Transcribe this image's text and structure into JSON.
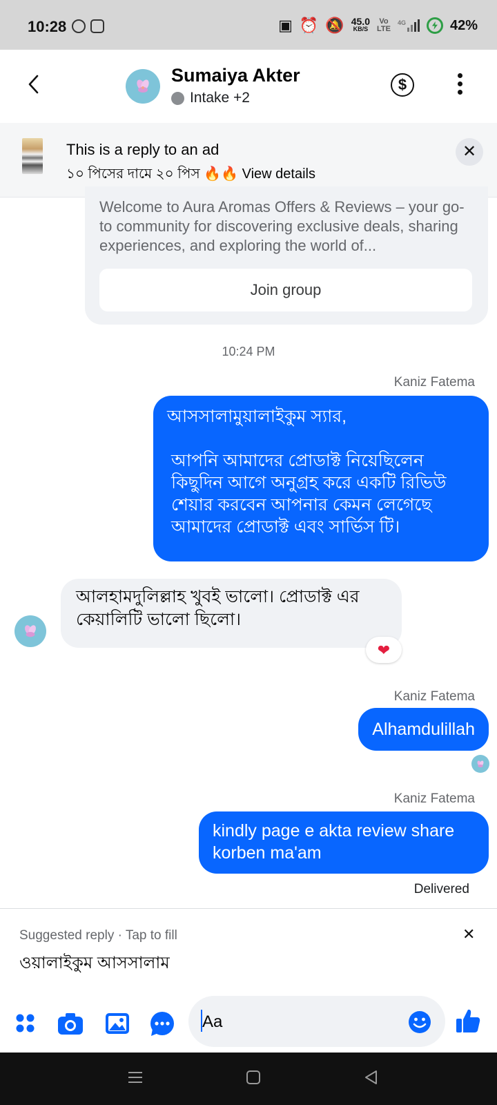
{
  "status_bar": {
    "time": "10:28",
    "net_speed_value": "45.0",
    "net_speed_unit": "KB/S",
    "volte_top": "Vo",
    "volte_bottom": "LTE",
    "signal_label": "4G",
    "battery": "42%"
  },
  "header": {
    "contact_name": "Sumaiya Akter",
    "subtitle": "Intake +2"
  },
  "ad_banner": {
    "title": "This is a reply to an ad",
    "subtitle": "১০ পিসের দামে ২০ পিস 🔥🔥 View details"
  },
  "group_card": {
    "description": "Welcome to Aura Aromas Offers & Reviews – your go-to community for discovering exclusive deals, sharing experiences, and exploring the world of...",
    "join_label": "Join group"
  },
  "thread": {
    "timestamp": "10:24 PM",
    "messages": [
      {
        "direction": "outgoing",
        "sender": "Kaniz Fatema",
        "line1": "আসসালামুয়ালাইকুম স্যার,",
        "line2": "আপনি আমাদের প্রোডাক্ট নিয়েছিলেন কিছুদিন আগে অনুগ্রহ করে একটি রিভিউ শেয়ার করবেন আপনার কেমন লেগেছে আমাদের প্রোডাক্ট এবং সার্ভিস টি।"
      },
      {
        "direction": "incoming",
        "sender": "Sumaiya Akter",
        "text": "আলহামদুলিল্লাহ খুবই ভালো। প্রোডাক্ট এর কেয়ালিটি ভালো ছিলো।",
        "reaction": "❤"
      },
      {
        "direction": "outgoing",
        "sender": "Kaniz Fatema",
        "text": "Alhamdulillah"
      },
      {
        "direction": "outgoing",
        "sender": "Kaniz Fatema",
        "text": "kindly page e akta review share korben ma'am",
        "status": "Delivered"
      }
    ]
  },
  "suggested_reply": {
    "hint": "Suggested reply · Tap to fill",
    "text": "ওয়ালাইকুম আসসালাম"
  },
  "composer": {
    "placeholder": "Aa"
  },
  "colors": {
    "accent": "#0866ff",
    "incoming_bubble": "#f0f2f5",
    "status_bar_bg": "#d6d6d6",
    "nav_bar_bg": "#111111",
    "reaction_heart": "#e41e3f",
    "battery_green": "#2e9e46"
  },
  "icons": {
    "back": "chevron-left-icon",
    "payment": "dollar-circle-icon",
    "more": "more-vertical-icon",
    "close": "close-icon",
    "apps": "four-dots-icon",
    "camera": "camera-icon",
    "gallery": "image-icon",
    "sticker": "chat-bubble-dots-icon",
    "emoji": "smiley-icon",
    "like": "thumbs-up-icon"
  }
}
